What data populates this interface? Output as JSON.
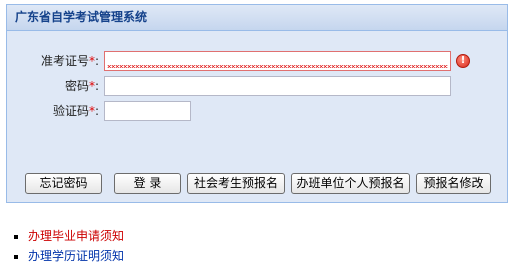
{
  "panel": {
    "title": "广东省自学考试管理系统"
  },
  "form": {
    "exam_id_label": "准考证号",
    "password_label": "密码",
    "captcha_label": "验证码",
    "required_mark": "*",
    "colon": ":",
    "exam_id_value": "",
    "password_value": "",
    "captcha_value": "",
    "error_icon_glyph": "!"
  },
  "buttons": {
    "forgot_password": "忘记密码",
    "login": "登 录",
    "public_prereg": "社会考生预报名",
    "unit_prereg": "办班单位个人预报名",
    "modify_prereg": "预报名修改"
  },
  "links": [
    {
      "label": "办理毕业申请须知",
      "color": "#cc0000"
    },
    {
      "label": "办理学历证明须知",
      "color": "#0033aa"
    }
  ],
  "colors": {
    "panel_border": "#99bbe8",
    "panel_bg": "#dfe8f6",
    "title_text": "#15428b",
    "required": "#e00000",
    "invalid_border": "#e07070"
  }
}
